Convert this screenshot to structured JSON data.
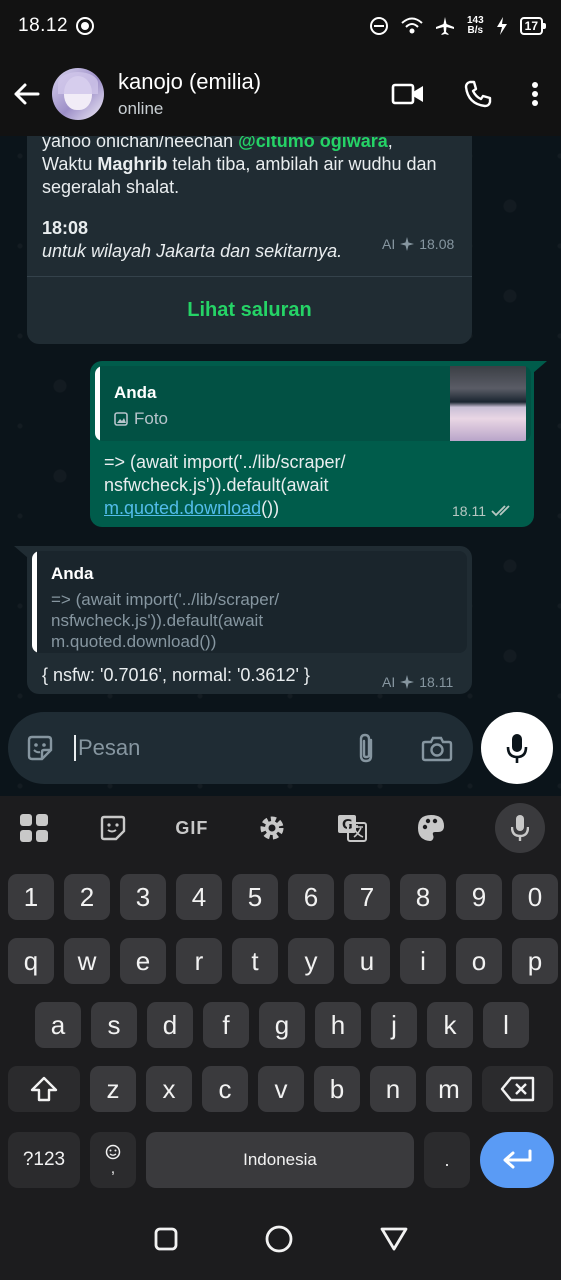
{
  "status_bar": {
    "time": "18.12",
    "net_speed_value": "143",
    "net_speed_unit": "B/s",
    "battery": "17"
  },
  "header": {
    "name": "kanojo (emilia)",
    "status": "online"
  },
  "msg1": {
    "line1_prefix": "yahoo onichan/neechan ",
    "mention": "@citumo ogiwara",
    "line1_suffix": ",",
    "line2_prefix": "Waktu ",
    "line2_bold": "Maghrib",
    "line2_suffix": " telah tiba, ambilah air wudhu dan",
    "line3": "segeralah shalat.",
    "time_bold": "18:08",
    "italic_note": "untuk wilayah Jakarta dan sekitarnya.",
    "ai_label": "AI",
    "timestamp": "18.08",
    "action": "Lihat saluran"
  },
  "msg2": {
    "quote_author": "Anda",
    "quote_type": "Foto",
    "line1": "=> (await import('../lib/scraper/",
    "line2": "nsfwcheck.js')).default(await",
    "link": "m.quoted.download",
    "line3_suffix": "())",
    "timestamp": "18.11"
  },
  "msg3": {
    "quote_author": "Anda",
    "quote_line1": "=> (await import('../lib/scraper/",
    "quote_line2": "nsfwcheck.js')).default(await",
    "quote_line3": "m.quoted.download())",
    "body": "{ nsfw: '0.7016', normal: '0.3612' }",
    "ai_label": "AI",
    "timestamp": "18.11"
  },
  "input": {
    "placeholder": "Pesan"
  },
  "keyboard": {
    "gif_label": "GIF",
    "row_numbers": [
      "1",
      "2",
      "3",
      "4",
      "5",
      "6",
      "7",
      "8",
      "9",
      "0"
    ],
    "row_top": [
      "q",
      "w",
      "e",
      "r",
      "t",
      "y",
      "u",
      "i",
      "o",
      "p"
    ],
    "row_middle": [
      "a",
      "s",
      "d",
      "f",
      "g",
      "h",
      "j",
      "k",
      "l"
    ],
    "row_bottom": [
      "z",
      "x",
      "c",
      "v",
      "b",
      "n",
      "m"
    ],
    "symbols_key": "?123",
    "comma_key": ",",
    "space_label": "Indonesia",
    "period_key": "."
  },
  "colors": {
    "accent": "#25d366",
    "outgoing_bubble": "#005c4b",
    "incoming_bubble": "#202c33",
    "link": "#53bdeb",
    "enter_key": "#5a9bf5"
  }
}
